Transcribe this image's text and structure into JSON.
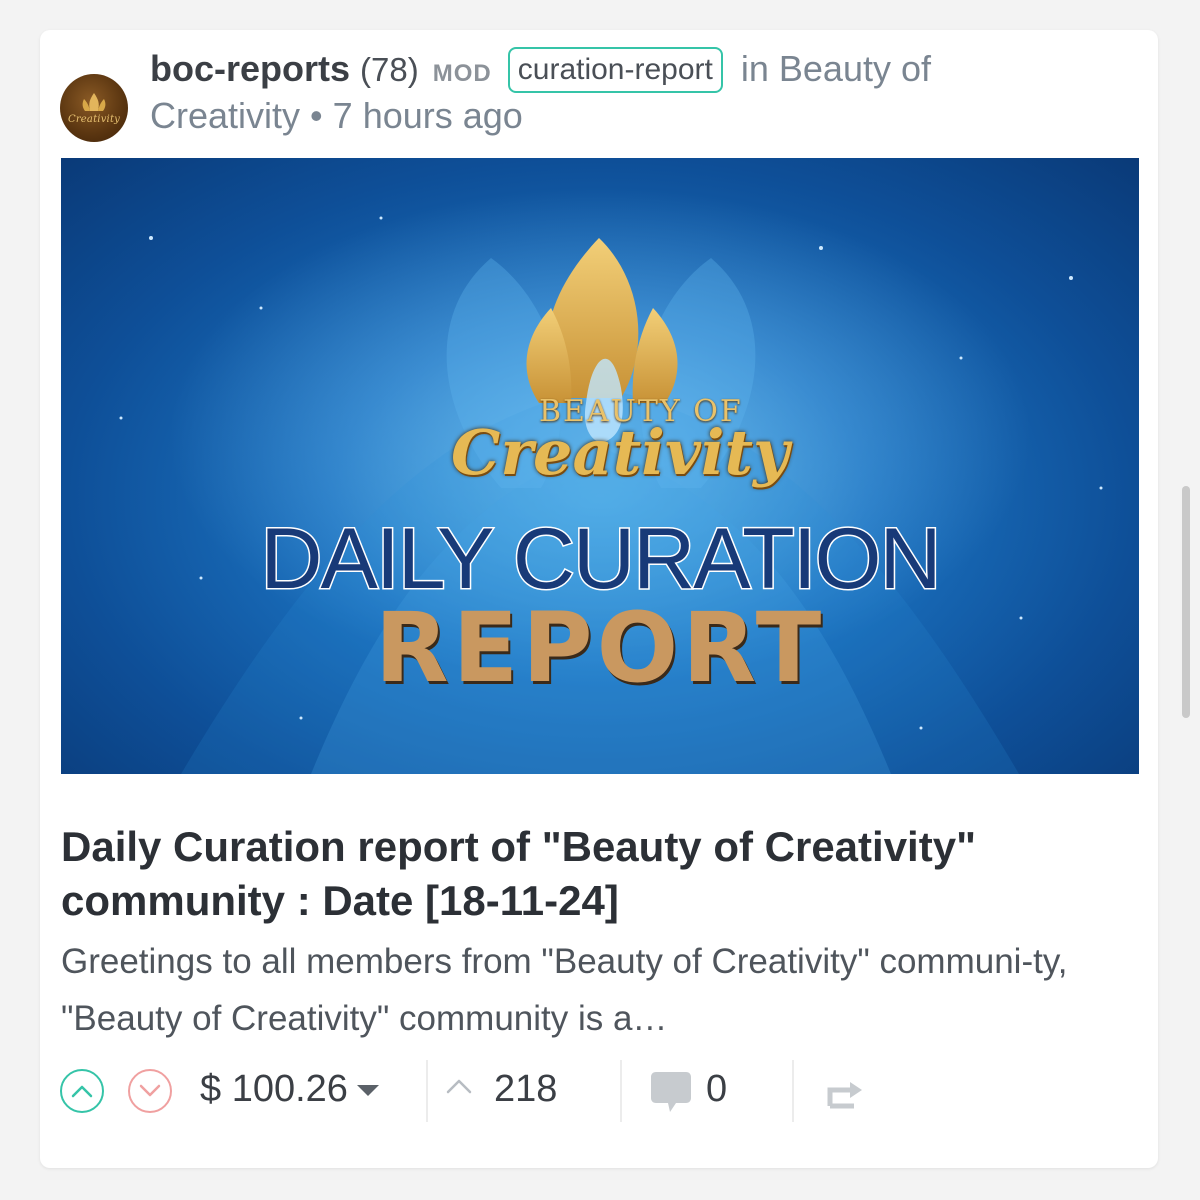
{
  "post": {
    "author": "boc-reports",
    "reputation": "(78)",
    "role_badge": "MOD",
    "tag": "curation-report",
    "community_prefix": "in Beauty of",
    "community_rest": "Creativity",
    "separator": "•",
    "time": "7 hours ago",
    "avatar_text": "Creativity",
    "title": "Daily Curation report of \"Beauty of Creativity\" community : Date [18-11-24]",
    "excerpt": "Greetings to all members from \"Beauty of Creativity\" communi-ty, \"Beauty of Creativity\" community is a…"
  },
  "banner": {
    "logo_line1": "BEAUTY OF",
    "logo_line2": "Creativity",
    "headline": "DAILY CURATION",
    "subheadline": "REPORT"
  },
  "footer": {
    "payout": "$ 100.26",
    "votes": "218",
    "comments": "0"
  },
  "icons": {
    "upvote": "chevron-up-icon",
    "downvote": "chevron-down-icon",
    "payout_menu": "caret-down-icon",
    "votes": "chevron-up-icon",
    "comments": "comment-bubble-icon",
    "reblog": "reblog-icon"
  },
  "colors": {
    "upvote": "#35c4a8",
    "downvote": "#f0a0a0",
    "tag_border": "#35c4a8",
    "title": "#2c3036",
    "meta": "#7a8591"
  }
}
